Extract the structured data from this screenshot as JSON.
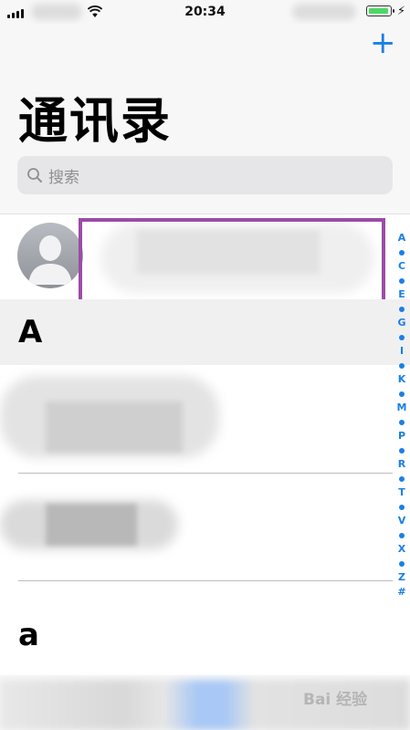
{
  "status_bar": {
    "time": "20:34"
  },
  "nav": {
    "title": "通讯录",
    "add_label": "+"
  },
  "search": {
    "placeholder": "搜索"
  },
  "sections": [
    {
      "letter": "A"
    },
    {
      "letter": "a"
    }
  ],
  "index_letters": [
    "A",
    "•",
    "C",
    "•",
    "E",
    "•",
    "G",
    "•",
    "I",
    "•",
    "K",
    "•",
    "M",
    "•",
    "P",
    "•",
    "R",
    "•",
    "T",
    "•",
    "V",
    "•",
    "X",
    "•",
    "Z",
    "#"
  ],
  "watermark": "Bai 经验",
  "colors": {
    "accent": "#1a7fe6",
    "highlight": "#9b4ca6",
    "battery": "#4cd964"
  }
}
